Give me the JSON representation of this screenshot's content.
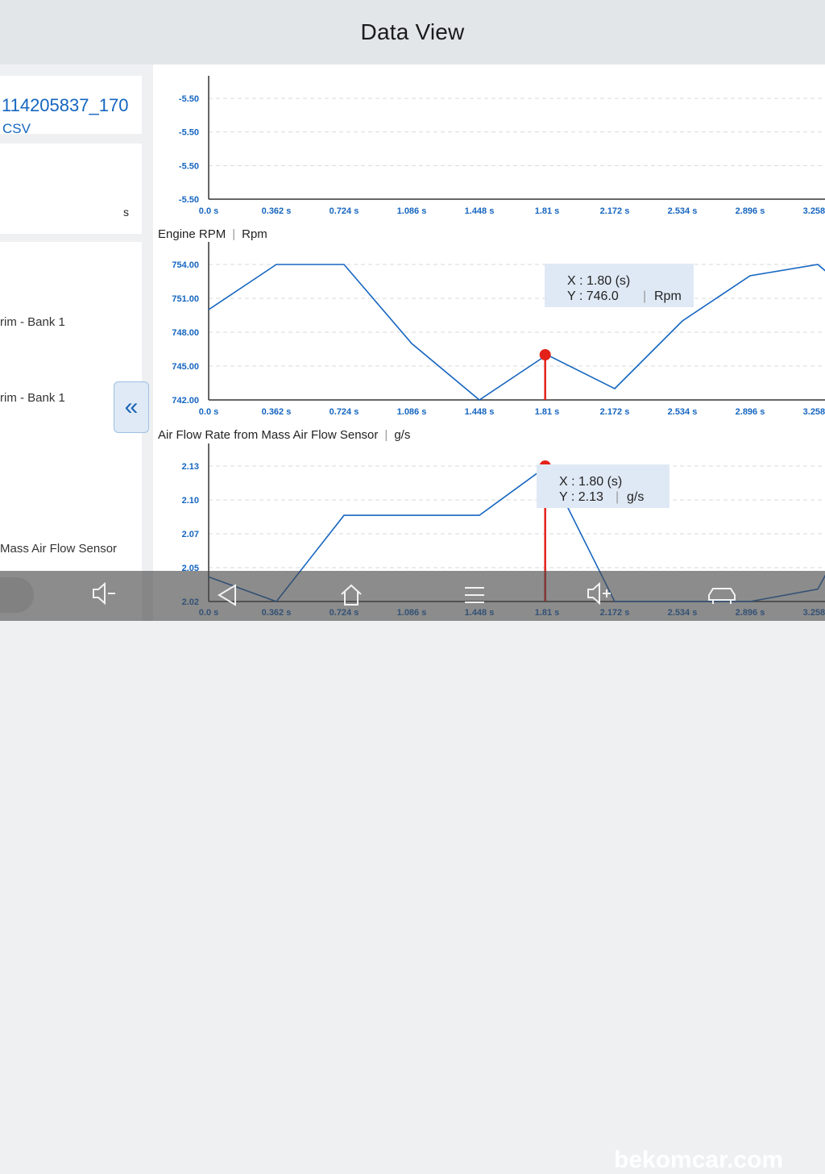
{
  "header": {
    "title": "Data View"
  },
  "sidebar": {
    "file_name": "114205837_170",
    "file_ext": "CSV",
    "unit": "s",
    "items": [
      "rim - Bank 1",
      "rim - Bank 1",
      "Mass Air Flow Sensor"
    ],
    "collapse_glyph": "«"
  },
  "chart_data": [
    {
      "type": "line",
      "title": "",
      "x": [
        "0.0 s",
        "0.362 s",
        "0.724 s",
        "1.086 s",
        "1.448 s",
        "1.81 s",
        "2.172 s",
        "2.534 s",
        "2.896 s",
        "3.258 s"
      ],
      "y_ticks": [
        "-5.50",
        "-5.50",
        "-5.50",
        "-5.50"
      ],
      "series": []
    },
    {
      "type": "line",
      "title": "Engine RPM",
      "unit": "Rpm",
      "x": [
        "0.0 s",
        "0.362 s",
        "0.724 s",
        "1.086 s",
        "1.448 s",
        "1.81 s",
        "2.172 s",
        "2.534 s",
        "2.896 s",
        "3.258 s"
      ],
      "y_ticks": [
        "754.00",
        "751.00",
        "748.00",
        "745.00",
        "742.00"
      ],
      "ylim": [
        742,
        754
      ],
      "series": [
        {
          "values": [
            [
              0.0,
              750.0
            ],
            [
              0.362,
              754.0
            ],
            [
              0.724,
              754.0
            ],
            [
              1.086,
              747.0
            ],
            [
              1.448,
              742.0
            ],
            [
              1.81,
              746.0
            ],
            [
              2.172,
              743.0
            ],
            [
              2.534,
              749.0
            ],
            [
              2.896,
              753.0
            ],
            [
              3.258,
              754.0
            ],
            [
              3.33,
              753.0
            ]
          ]
        }
      ],
      "cursor": {
        "x": 1.8,
        "y": 746.0,
        "x_text": "X : 1.80 (s)",
        "y_text": "Y : 746.0",
        "unit": "Rpm"
      }
    },
    {
      "type": "line",
      "title": "Air Flow Rate from Mass Air Flow Sensor",
      "unit": "g/s",
      "x": [
        "0.0 s",
        "0.362 s",
        "0.724 s",
        "1.086 s",
        "1.448 s",
        "1.81 s",
        "2.172 s",
        "2.534 s",
        "2.896 s",
        "3.258 s"
      ],
      "y_ticks": [
        "2.13",
        "2.10",
        "2.07",
        "2.05",
        "2.02"
      ],
      "ylim": [
        2.02,
        2.13
      ],
      "series": [
        {
          "values": [
            [
              0.0,
              2.04
            ],
            [
              0.362,
              2.02
            ],
            [
              0.724,
              2.09
            ],
            [
              1.086,
              2.09
            ],
            [
              1.448,
              2.09
            ],
            [
              1.81,
              2.13
            ],
            [
              2.172,
              2.02
            ],
            [
              2.534,
              2.02
            ],
            [
              2.896,
              2.02
            ],
            [
              3.258,
              2.03
            ],
            [
              3.33,
              2.05
            ]
          ]
        }
      ],
      "cursor": {
        "x": 1.8,
        "y": 2.13,
        "x_text": "X : 1.80 (s)",
        "y_text": "Y : 2.13",
        "unit": "g/s"
      }
    }
  ],
  "navbar": {
    "icons": [
      "volume-down-icon",
      "back-icon",
      "home-icon",
      "menu-icon",
      "volume-up-icon",
      "car-icon"
    ],
    "volume_down_glyph": "◁-",
    "watermark": "bekomcar.com"
  },
  "colors": {
    "line": "#1565c0",
    "cursor": "#e32119",
    "tick_text": "#1565c0",
    "tooltip_bg": "#dfe9f5"
  }
}
